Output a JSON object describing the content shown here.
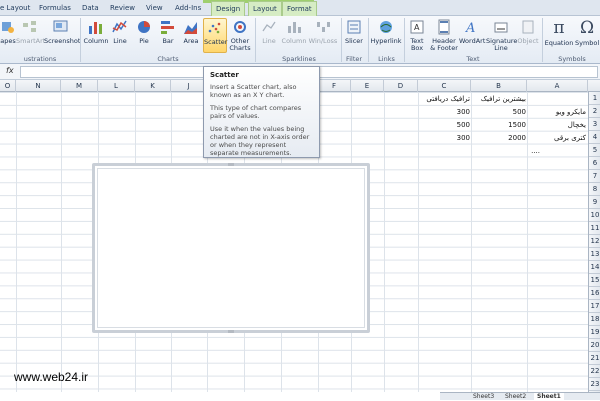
{
  "tabs": [
    {
      "label": "e Layout"
    },
    {
      "label": "Formulas"
    },
    {
      "label": "Data"
    },
    {
      "label": "Review"
    },
    {
      "label": "View"
    },
    {
      "label": "Add-Ins"
    },
    {
      "label": "Design"
    },
    {
      "label": "Layout"
    },
    {
      "label": "Format"
    }
  ],
  "ribbon": {
    "illustrations": {
      "shapes": "apes",
      "smartart": "SmartArt",
      "screenshot": "Screenshot",
      "label": "ustrations"
    },
    "charts": {
      "column": "Column",
      "line": "Line",
      "pie": "Pie",
      "bar": "Bar",
      "area": "Area",
      "scatter": "Scatter",
      "other": "Other",
      "other2": "Charts",
      "label": "Charts"
    },
    "sparklines": {
      "line": "Line",
      "column": "Column",
      "winloss": "Win/Loss",
      "label": "Sparklines"
    },
    "filter": {
      "slicer": "Slicer",
      "label": "Filter"
    },
    "links": {
      "hyperlink": "Hyperlink",
      "label": "Links"
    },
    "text": {
      "textbox": "Text",
      "textbox2": "Box",
      "header": "Header",
      "header2": "& Footer",
      "wordart": "WordArt",
      "signature": "Signature",
      "signature2": "Line",
      "object": "Object",
      "label": "Text"
    },
    "symbols": {
      "equation": "Equation",
      "symbol": "Symbol",
      "label": "Symbols",
      "pi": "π",
      "omega": "Ω"
    }
  },
  "formula_bar": {
    "fx": "fx",
    "value": ""
  },
  "columns": [
    "O",
    "N",
    "M",
    "L",
    "K",
    "J",
    "I",
    "H",
    "G",
    "F",
    "E",
    "D",
    "C",
    "B",
    "A"
  ],
  "rows": [
    "1",
    "2",
    "3",
    "4",
    "5",
    "6",
    "7",
    "8",
    "9",
    "10",
    "11",
    "12",
    "13",
    "14",
    "15",
    "16",
    "17",
    "18",
    "19",
    "20",
    "21",
    "22",
    "23"
  ],
  "cells": {
    "C1": "ترافیک دریافتی",
    "B1": "بیشترین ترافیک",
    "A2": "مایکرو ویو",
    "B2": "500",
    "C2": "300",
    "A3": "یخچال",
    "B3": "1500",
    "C3": "500",
    "A4": "کتری برقی",
    "B4": "2000",
    "C4": "300",
    "B5": "...."
  },
  "tooltip": {
    "title": "Scatter",
    "p1": "Insert a Scatter chart, also known as an X Y chart.",
    "p2": "This type of chart compares pairs of values.",
    "p3": "Use it when the values being charted are not in X-axis order or when they represent separate measurements."
  },
  "watermark": "www.web24.ir",
  "sheets": [
    {
      "label": "Sheet3"
    },
    {
      "label": "Sheet2"
    },
    {
      "label": "Sheet1"
    }
  ]
}
